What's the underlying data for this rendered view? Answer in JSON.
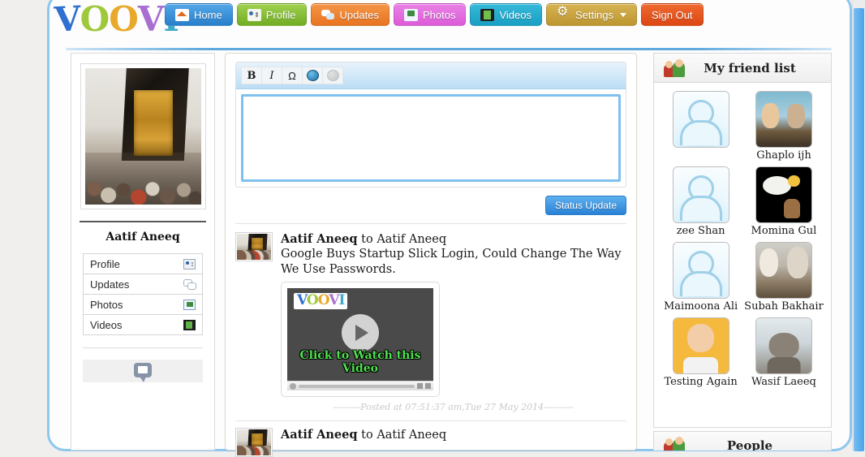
{
  "brand": {
    "logo_letters": [
      "V",
      "O",
      "O",
      "V",
      "I"
    ]
  },
  "nav": {
    "items": [
      {
        "label": "Home",
        "icon": "home-icon"
      },
      {
        "label": "Profile",
        "icon": "id-card-icon"
      },
      {
        "label": "Updates",
        "icon": "chat-bubbles-icon"
      },
      {
        "label": "Photos",
        "icon": "photo-icon"
      },
      {
        "label": "Videos",
        "icon": "film-icon"
      },
      {
        "label": "Settings",
        "icon": "gear-icon",
        "has_dropdown": true
      },
      {
        "label": "Sign Out",
        "icon": "none"
      }
    ],
    "colors": {
      "home": "#2a7fcb",
      "profile": "#73ad24",
      "updates": "#e87420",
      "photos": "#dd5bd8",
      "videos": "#1ba0c4",
      "settings": "#bd9631",
      "signout": "#dd4713"
    }
  },
  "sidebar": {
    "profile_name": "Aatif Aneeq",
    "avatar_alt": "kaaba-photo",
    "menu": [
      {
        "label": "Profile",
        "icon": "id-card-icon"
      },
      {
        "label": "Updates",
        "icon": "chat-bubbles-icon"
      },
      {
        "label": "Photos",
        "icon": "photo-icon"
      },
      {
        "label": "Videos",
        "icon": "film-icon"
      }
    ],
    "extra_icon": "speech-bubble-icon"
  },
  "composer": {
    "toolbar": [
      {
        "label": "B",
        "name": "bold-button"
      },
      {
        "label": "I",
        "name": "italic-button"
      },
      {
        "label": "Ω",
        "name": "special-character-button"
      },
      {
        "label": "",
        "name": "insert-link-button"
      },
      {
        "label": "",
        "name": "unlink-button"
      }
    ],
    "textarea_value": "",
    "textarea_placeholder": "",
    "submit_label": "Status Update"
  },
  "feed": {
    "posts": [
      {
        "author": "Aatif Aneeq",
        "connector": "to",
        "target": "Aatif Aneeq",
        "text": "Google Buys Startup Slick Login, Could Change The Way We Use Passwords.",
        "video": {
          "logo": "VOOVI",
          "caption": "Click to Watch this Video",
          "play_icon": "play-icon"
        },
        "timestamp": "---------Posted at 07:51:37 am,Tue 27 May 2014----------"
      },
      {
        "author": "Aatif Aneeq",
        "connector": "to",
        "target": "Aatif Aneeq",
        "text": "",
        "timestamp": ""
      }
    ]
  },
  "friend_list": {
    "title": "My friend list",
    "icon": "two-people-icon",
    "friends": [
      {
        "name": "",
        "thumb": "placeholder-person"
      },
      {
        "name": "Ghaplo ijh",
        "thumb": "couple-photo"
      },
      {
        "name": "zee Shan",
        "thumb": "placeholder-person"
      },
      {
        "name": "Momina Gul",
        "thumb": "angel-artwork"
      },
      {
        "name": "Maimoona Ali",
        "thumb": "placeholder-person"
      },
      {
        "name": "Subah Bakhair",
        "thumb": "group-photo"
      },
      {
        "name": "Testing Again",
        "thumb": "baby-photo"
      },
      {
        "name": "Wasif Laeeq",
        "thumb": "cat-photo"
      }
    ]
  },
  "second_panel": {
    "title": "People",
    "icon": "two-people-icon"
  }
}
